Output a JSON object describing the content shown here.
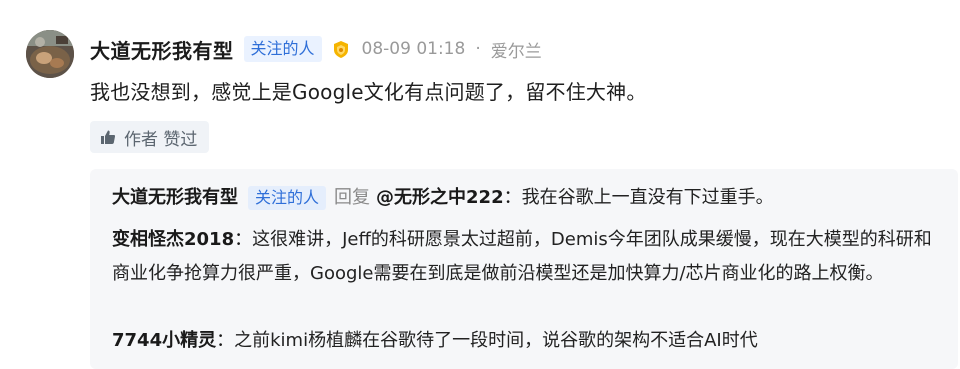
{
  "comment": {
    "author": "大道无形我有型",
    "badge": "关注的人",
    "level_icon": "gold-badge-icon",
    "time": "08-09 01:18",
    "separator": "·",
    "location": "爱尔兰",
    "text": "我也没想到，感觉上是Google文化有点问题了，留不住大神。",
    "like_label": "作者 赞过"
  },
  "replies": [
    {
      "author": "大道无形我有型",
      "badge": "关注的人",
      "action": "回复",
      "target": "@无形之中222",
      "colon": "：",
      "text": "我在谷歌上一直没有下过重手。"
    },
    {
      "author": "变相怪杰2018",
      "colon": "：",
      "text": "这很难讲，Jeff的科研愿景太过超前，Demis今年团队成果缓慢，现在大模型的科研和商业化争抢算力很严重，Google需要在到底是做前沿模型还是加快算力/芯片商业化的路上权衡。"
    },
    {
      "author": "7744小精灵",
      "colon": "：",
      "text": "之前kimi杨植麟在谷歌待了一段时间，说谷歌的架构不适合AI时代"
    }
  ],
  "colors": {
    "badge_text": "#2f6fd8",
    "badge_bg": "#eaf2ff",
    "reply_bg": "#f6f7f9",
    "muted": "#9a9a9a"
  }
}
